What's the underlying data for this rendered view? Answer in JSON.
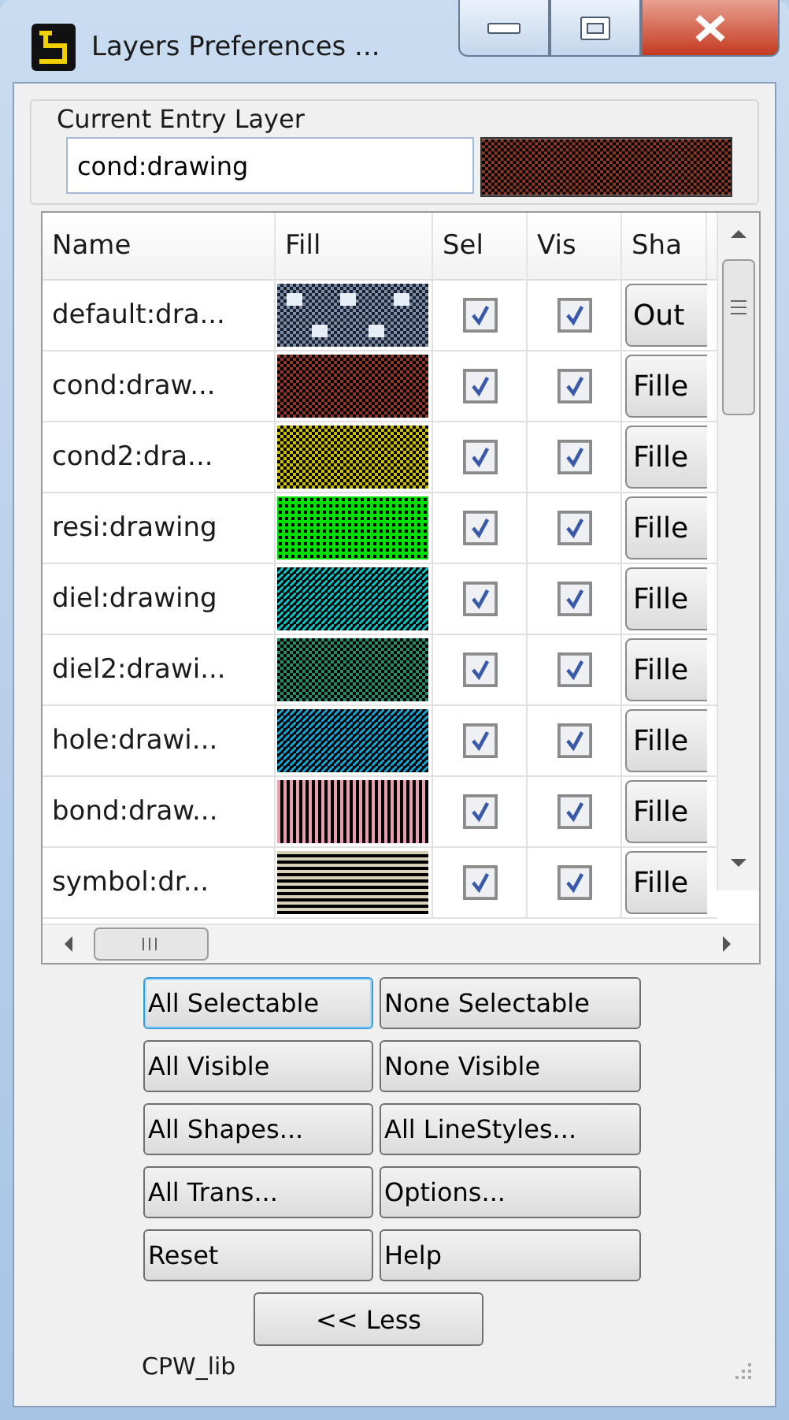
{
  "window": {
    "title": "Layers Preferences ..."
  },
  "current_entry": {
    "label": "Current Entry Layer",
    "value": "cond:drawing",
    "color": "#8b3a2a",
    "kind": "checker"
  },
  "table": {
    "columns": [
      "Name",
      "Fill",
      "Sel",
      "Vis",
      "Sha"
    ],
    "rows": [
      {
        "name": "default:dra...",
        "color": "#7d8ea8",
        "kind": "grid",
        "sel": true,
        "vis": true,
        "shape": "Out"
      },
      {
        "name": "cond:draw...",
        "color": "#8b3a2a",
        "kind": "checker",
        "sel": true,
        "vis": true,
        "shape": "Fille"
      },
      {
        "name": "cond2:dra...",
        "color": "#c8c000",
        "kind": "checker",
        "sel": true,
        "vis": true,
        "shape": "Fille"
      },
      {
        "name": "resi:drawing",
        "color": "#00e000",
        "kind": "dots",
        "sel": true,
        "vis": true,
        "shape": "Fille"
      },
      {
        "name": "diel:drawing",
        "color": "#00c8c8",
        "kind": "diagonal",
        "sel": true,
        "vis": true,
        "shape": "Fille"
      },
      {
        "name": "diel2:drawi...",
        "color": "#2e8b6a",
        "kind": "checker",
        "sel": true,
        "vis": true,
        "shape": "Fille"
      },
      {
        "name": "hole:drawi...",
        "color": "#18a8d8",
        "kind": "diagonal",
        "sel": true,
        "vis": true,
        "shape": "Fille"
      },
      {
        "name": "bond:draw...",
        "color": "#e8a0b0",
        "kind": "vertical",
        "sel": true,
        "vis": true,
        "shape": "Fille"
      },
      {
        "name": "symbol:dr...",
        "color": "#d8d0b8",
        "kind": "horizontal",
        "sel": true,
        "vis": true,
        "shape": "Fille"
      }
    ]
  },
  "buttons": [
    {
      "label": "All Selectable",
      "focused": true
    },
    {
      "label": "None Selectable",
      "focused": false
    },
    {
      "label": "All Visible",
      "focused": false
    },
    {
      "label": "None Visible",
      "focused": false
    },
    {
      "label": "All Shapes...",
      "focused": false
    },
    {
      "label": "All LineStyles...",
      "focused": false
    },
    {
      "label": "All Trans...",
      "focused": false
    },
    {
      "label": "Options...",
      "focused": false
    },
    {
      "label": "Reset",
      "focused": false
    },
    {
      "label": "Help",
      "focused": false
    }
  ],
  "less_button": "<< Less",
  "status": "CPW_lib"
}
